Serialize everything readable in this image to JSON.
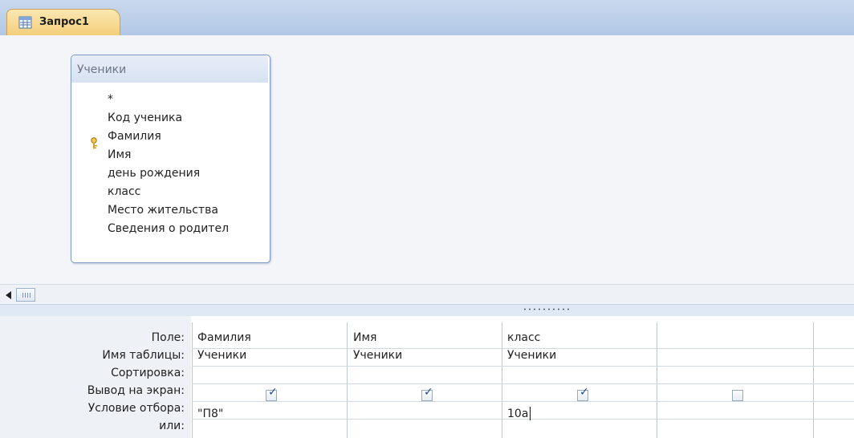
{
  "window": {
    "tab_title": "Запрос1"
  },
  "table_box": {
    "title": "Ученики",
    "fields": [
      "*",
      "Код ученика",
      "Фамилия",
      "Имя",
      "день рождения",
      "класс",
      "Место жительства",
      "Сведения о родител"
    ]
  },
  "grid": {
    "row_labels": [
      "Поле:",
      "Имя таблицы:",
      "Сортировка:",
      "Вывод на экран:",
      "Условие отбора:",
      "или:"
    ],
    "columns": [
      {
        "field": "Фамилия",
        "table": "Ученики",
        "sort": "",
        "show": true,
        "criteria": "\"П8\""
      },
      {
        "field": "Имя",
        "table": "Ученики",
        "sort": "",
        "show": true,
        "criteria": ""
      },
      {
        "field": "класс",
        "table": "Ученики",
        "sort": "",
        "show": true,
        "criteria": "10а"
      },
      {
        "field": "",
        "table": "",
        "sort": "",
        "show": false,
        "criteria": ""
      }
    ]
  },
  "icons": {
    "tab": "query-icon",
    "primary_key": "key-icon",
    "scroll_left": "triangle-left-icon",
    "splitter": "grip-icon"
  },
  "colors": {
    "tab_active": "#f4cf7a",
    "title_bar": "#c9d9ee",
    "text": "#222222",
    "check": "#1f4c93"
  }
}
